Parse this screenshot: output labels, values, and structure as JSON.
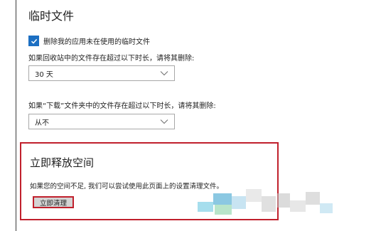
{
  "temp_files": {
    "title": "临时文件",
    "delete_unused_apps_label": "删除我的应用未在使用的临时文件",
    "delete_unused_apps_checked": true,
    "recycle_bin_label": "如果回收站中的文件存在超过以下时长，请将其删除:",
    "recycle_bin_value": "30 天",
    "downloads_label": "如果“下载”文件夹中的文件存在超过以下时长，请将其删除:",
    "downloads_value": "从不"
  },
  "free_space": {
    "title": "立即释放空间",
    "description": "如果您的空间不足, 我们可以尝试使用此页面上的设置清理文件。",
    "clean_button_label": "立即清理"
  },
  "colors": {
    "accent_blue": "#1c6fc2",
    "highlight_red": "#c0202c"
  },
  "icons": {
    "checkbox": "checkmark-icon",
    "dropdown": "chevron-down-icon"
  }
}
